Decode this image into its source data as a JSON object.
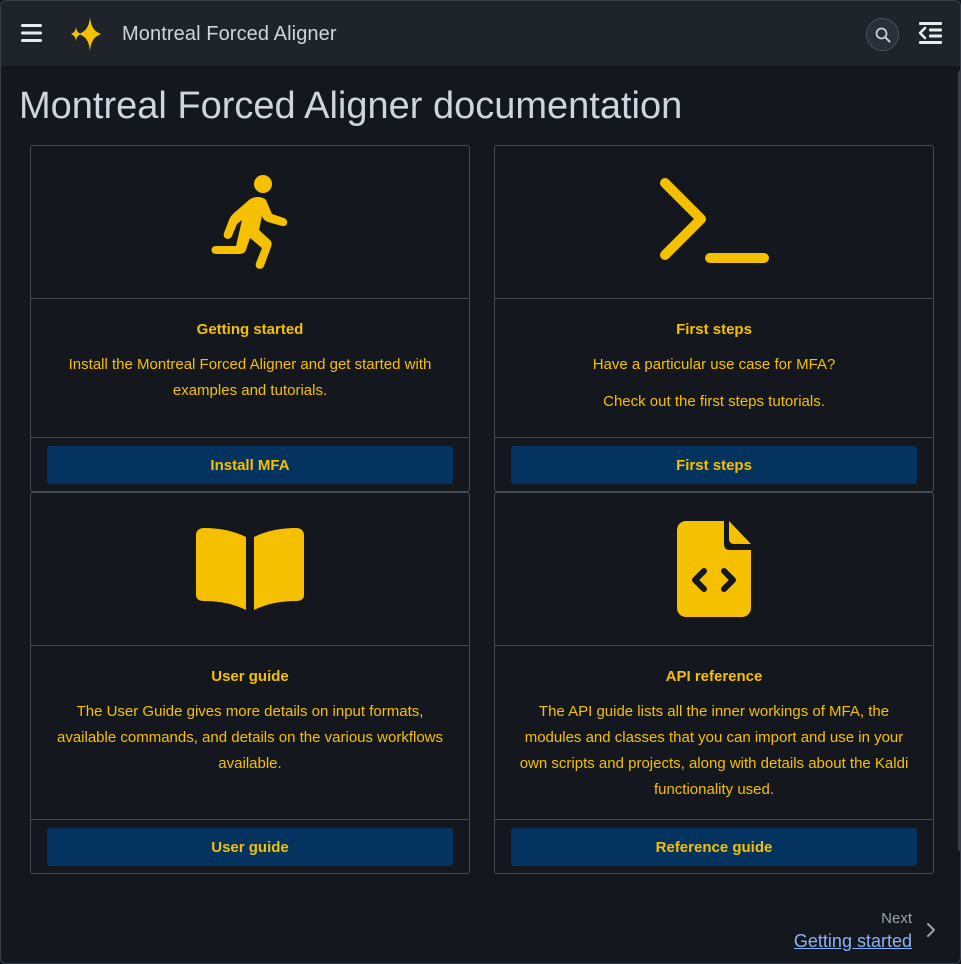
{
  "header": {
    "brand": "Montreal Forced Aligner",
    "menu_icon": "hamburger-menu-icon",
    "logo_icon": "sparkle-logo-icon",
    "search_icon": "search-icon",
    "toc_icon": "table-of-contents-icon"
  },
  "page": {
    "title": "Montreal Forced Aligner documentation"
  },
  "cards": [
    {
      "icon": "running-person-icon",
      "title": "Getting started",
      "text": [
        "Install the Montreal Forced Aligner and get started with examples and tutorials."
      ],
      "button": "Install MFA"
    },
    {
      "icon": "terminal-prompt-icon",
      "title": "First steps",
      "text": [
        "Have a particular use case for MFA?",
        "Check out the first steps tutorials."
      ],
      "button": "First steps"
    },
    {
      "icon": "open-book-icon",
      "title": "User guide",
      "text": [
        "The User Guide gives more details on input formats, available commands, and details on the various workflows available."
      ],
      "button": "User guide"
    },
    {
      "icon": "code-file-icon",
      "title": "API reference",
      "text": [
        "The API guide lists all the inner workings of MFA, the modules and classes that you can import and use in your own scripts and projects, along with details about the Kaldi functionality used."
      ],
      "button": "Reference guide"
    }
  ],
  "footer_nav": {
    "next_label": "Next",
    "next_title": "Getting started",
    "chevron_icon": "chevron-right-icon"
  },
  "colors": {
    "background": "#14181e",
    "header": "#1f232a",
    "accent": "#f5c000",
    "button": "#043360",
    "link": "#8ab4f8"
  }
}
